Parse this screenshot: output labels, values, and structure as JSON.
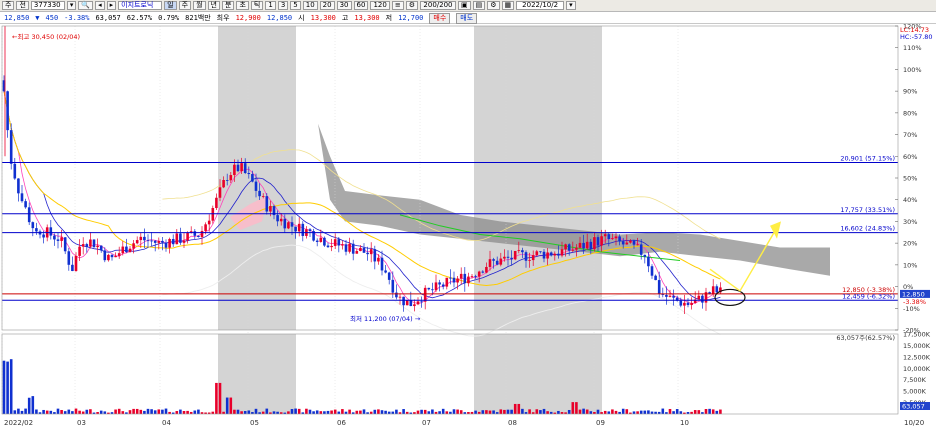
{
  "toolbar": {
    "item_code": "377330",
    "company_name": "이지트로닉",
    "buttons": [
      "주",
      "전"
    ],
    "tab_labels": [
      "일",
      "주",
      "월",
      "년",
      "분",
      "초",
      "틱"
    ],
    "period_buttons": [
      "1",
      "3",
      "5",
      "10",
      "20",
      "30",
      "60",
      "120"
    ],
    "count_label": "200/200",
    "date": "2022/10/2"
  },
  "info_bar": {
    "price": "12,850",
    "change": "450",
    "change_pct": "-3.38%",
    "volume": "63,057",
    "turnover_pct": "62.57%",
    "vol_ratio": "0.79%",
    "amount": "821백만",
    "label_best": "최우",
    "best_price": "12,900",
    "best_price2": "12,850",
    "label_open": "시",
    "open": "13,300",
    "label_high": "고",
    "high": "13,300",
    "label_low": "저",
    "low": "12,700",
    "buy": "매수",
    "sell": "매도"
  },
  "chart_data": {
    "type": "candlestick",
    "annotations": {
      "high_label": "최고 30,450 (02/04)",
      "low_label": "최저 11,200 (07/04)",
      "volume_label": "63,057주(62.57%)"
    },
    "hlines": [
      {
        "label": "20,901 (57.15%)",
        "value_pct": 57.15,
        "color": "#0000cc"
      },
      {
        "label": "17,757 (33.51%)",
        "value_pct": 33.51,
        "color": "#0000cc"
      },
      {
        "label": "16,602 (24.83%)",
        "value_pct": 24.83,
        "color": "#0000cc"
      },
      {
        "label": "12,850 (-3.38%)",
        "value_pct": -3.38,
        "color": "#cc0000"
      },
      {
        "label": "12,459 (-6.32%)",
        "value_pct": -6.32,
        "color": "#0000cc"
      }
    ],
    "right_top": {
      "lc": "LC:14.73",
      "hc": "HC:-57.80"
    },
    "price_axis": [
      "120%",
      "110%",
      "100%",
      "90%",
      "80%",
      "70%",
      "60%",
      "50%",
      "40%",
      "30%",
      "20%",
      "10%",
      "0%",
      "-10%",
      "-20%"
    ],
    "price_ylim": [
      -20,
      120
    ],
    "price_tag": "12,850",
    "price_tag_pct": "-3.38%",
    "volume_axis": [
      "17,500K",
      "15,000K",
      "12,500K",
      "10,000K",
      "7,500K",
      "5,000K",
      "2,500K"
    ],
    "volume_ylim": [
      0,
      17500
    ],
    "volume_tag": "63,057",
    "x_labels": [
      "2022/02",
      "03",
      "04",
      "05",
      "06",
      "07",
      "08",
      "09",
      "10"
    ],
    "x_end_label": "10/20",
    "colors": {
      "up": "#e8002a",
      "down": "#1030d0",
      "ma5": "#ff44bb",
      "ma20": "#ffcc00",
      "ma60": "#2222cc",
      "band": "#f0e090",
      "cloud": "#8c8c8c",
      "green": "#22cc22",
      "arrow": "#ffee44"
    }
  }
}
